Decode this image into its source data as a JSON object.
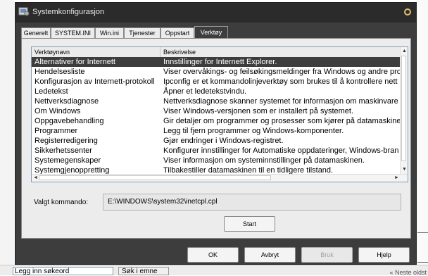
{
  "window": {
    "title": "Systemkonfigurasjon"
  },
  "tabs": [
    {
      "label": "Generelt"
    },
    {
      "label": "SYSTEM.INI"
    },
    {
      "label": "Win.ini"
    },
    {
      "label": "Tjenester"
    },
    {
      "label": "Oppstart"
    },
    {
      "label": "Verktøy",
      "active": true
    }
  ],
  "list": {
    "columns": [
      "Verktøynavn",
      "Beskrivelse"
    ],
    "rows": [
      {
        "name": "Alternativer for Internett",
        "desc": "Innstillinger for Internett Explorer.",
        "selected": true
      },
      {
        "name": "Hendelsesliste",
        "desc": "Viser overvåkings- og feilsøkingsmeldinger fra Windows og andre pro"
      },
      {
        "name": "Konfigurasjon av Internett-protokoll",
        "desc": "Ipconfig er et kommandolinjeverktøy som brukes til å kontrollere nett"
      },
      {
        "name": "Ledetekst",
        "desc": "Åpner et ledetekstvindu."
      },
      {
        "name": "Nettverksdiagnose",
        "desc": "Nettverksdiagnose skanner systemet for informasjon om maskinvare"
      },
      {
        "name": "Om Windows",
        "desc": "Viser Windows-versjonen som er installert på systemet."
      },
      {
        "name": "Oppgavebehandling",
        "desc": "Gir detaljer om programmer og prosesser som kjører på datamaskinen"
      },
      {
        "name": "Programmer",
        "desc": "Legg til fjern programmer og Windows-komponenter."
      },
      {
        "name": "Registerredigering",
        "desc": "Gjør endringer i Windows-registret."
      },
      {
        "name": "Sikkerhetssenter",
        "desc": "Konfigurer innstillinger for Automatiske oppdateringer, Windows-bran"
      },
      {
        "name": "Systemegenskaper",
        "desc": "Viser informasjon om systeminnstillinger på datamaskinen."
      },
      {
        "name": "Systemgjenoppretting",
        "desc": "Tilbakestiller datamaskinen til en tidligere tilstand."
      }
    ]
  },
  "command": {
    "label": "Valgt kommando:",
    "value": "E:\\WINDOWS\\system32\\inetcpl.cpl"
  },
  "buttons": {
    "start": "Start",
    "ok": "OK",
    "cancel": "Avbryt",
    "apply": "Bruk",
    "help": "Hjelp"
  },
  "background": {
    "search_placeholder": "Legg inn søkeord",
    "search_button": "Søk i emne",
    "next_link": "« Neste oldst"
  },
  "colors": {
    "titlebar": "#2b2b2b",
    "selection": "#3d3d3d",
    "panel": "#ececec"
  }
}
